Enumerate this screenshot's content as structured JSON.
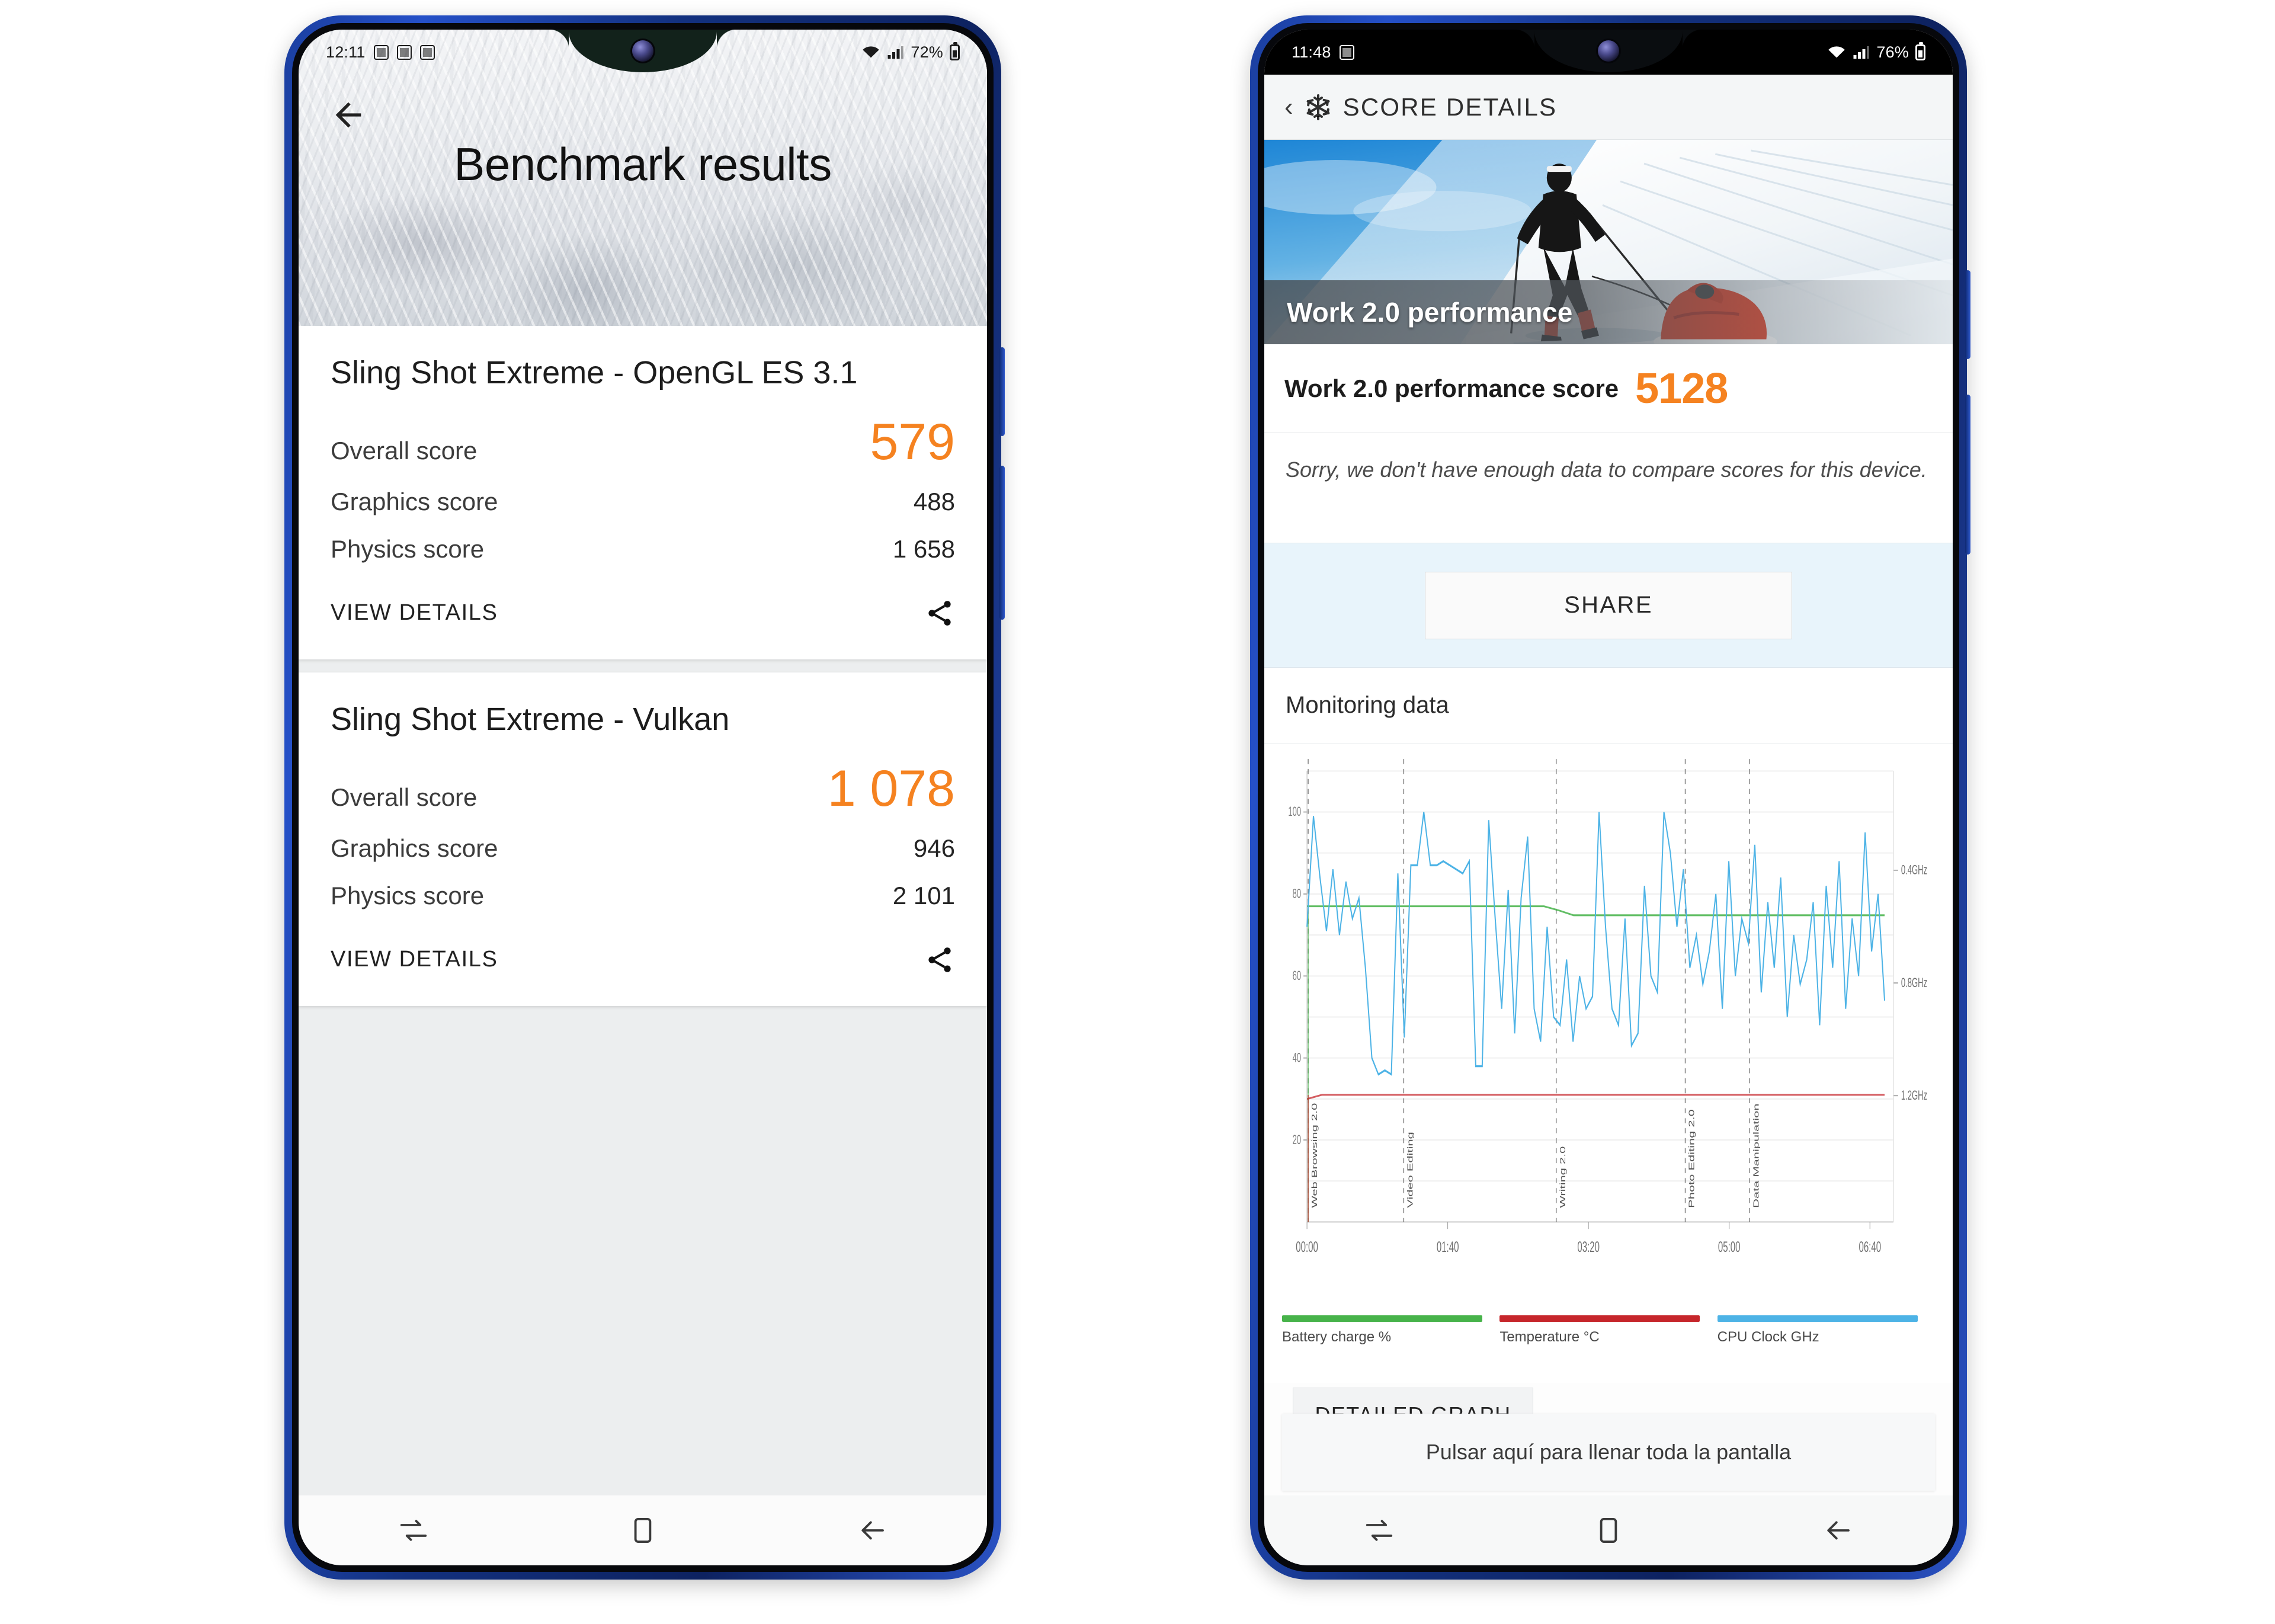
{
  "left_phone": {
    "status_bar": {
      "time": "12:11",
      "battery_percent": "72%",
      "icons": [
        "image-icon",
        "screenshot-icon",
        "alarm-icon",
        "wifi-icon",
        "signal-icon",
        "battery-icon"
      ]
    },
    "back_icon": "back-arrow-icon",
    "header_title": "Benchmark results",
    "cards": [
      {
        "title": "Sling Shot Extreme - OpenGL ES 3.1",
        "rows": [
          {
            "label": "Overall score",
            "value": "579",
            "accent": true
          },
          {
            "label": "Graphics score",
            "value": "488",
            "accent": false
          },
          {
            "label": "Physics score",
            "value": "1 658",
            "accent": false
          }
        ],
        "details_label": "VIEW DETAILS",
        "share_icon": "share-icon"
      },
      {
        "title": "Sling Shot Extreme - Vulkan",
        "rows": [
          {
            "label": "Overall score",
            "value": "1 078",
            "accent": true
          },
          {
            "label": "Graphics score",
            "value": "946",
            "accent": false
          },
          {
            "label": "Physics score",
            "value": "2 101",
            "accent": false
          }
        ],
        "details_label": "VIEW DETAILS",
        "share_icon": "share-icon"
      }
    ],
    "nav_bar": {
      "recents_icon": "recents-icon",
      "home_icon": "home-icon",
      "back_icon": "back-icon"
    }
  },
  "right_phone": {
    "status_bar": {
      "time": "11:48",
      "battery_percent": "76%",
      "icons": [
        "screenshot-icon",
        "wifi-icon",
        "signal-icon",
        "battery-icon"
      ]
    },
    "app_bar": {
      "back_chevron": "chevron-left-icon",
      "brand_icon": "snowflake-icon",
      "title": "SCORE DETAILS"
    },
    "banner": {
      "caption": "Work 2.0 performance",
      "image_alt": "skier-pulling-sled-photo"
    },
    "score": {
      "label": "Work 2.0 performance score",
      "value": "5128"
    },
    "note": "Sorry, we don't have enough data to compare scores for this device.",
    "share_label": "SHARE",
    "monitoring_heading": "Monitoring data",
    "detailed_graph_label": "DETAILED GRAPH",
    "fullscreen_hint": "Pulsar aquí para llenar toda la pantalla",
    "nav_bar": {
      "recents_icon": "recents-icon",
      "home_icon": "home-icon",
      "back_icon": "back-icon"
    }
  },
  "colors": {
    "accent_orange": "#f58220",
    "battery_green": "#47b34a",
    "temperature_red": "#c6262b",
    "cpu_blue": "#4db3e6",
    "phone_blue": "#1b3fa0"
  },
  "chart_data": {
    "type": "line",
    "title": "Monitoring data",
    "xlabel": "",
    "ylabel": "",
    "grid": true,
    "legend_position": "bottom",
    "x_ticks": [
      "00:00",
      "01:40",
      "03:20",
      "05:00",
      "06:40"
    ],
    "y_left_ticks": [
      "100",
      "80",
      "60",
      "40",
      "20"
    ],
    "y_left_range": [
      0,
      110
    ],
    "y_right_ticks": [
      "1.2GHz",
      "0.8GHz",
      "0.4GHz"
    ],
    "annotations": [
      {
        "label": "Web Browsing 2.0",
        "x_time": "00:00"
      },
      {
        "label": "Video Editing",
        "x_time": "01:07"
      },
      {
        "label": "Writing 2.0",
        "x_time": "02:52"
      },
      {
        "label": "Photo Editing 2.0",
        "x_time": "04:25"
      },
      {
        "label": "Data Manipulation",
        "x_time": "05:12"
      }
    ],
    "series": [
      {
        "name": "Battery charge %",
        "color": "#47b34a",
        "unit": "%",
        "values": [
          77,
          77,
          77,
          77,
          77,
          77,
          77,
          77,
          77,
          77,
          77,
          77,
          77,
          77,
          77,
          77,
          77,
          76,
          76,
          76,
          76,
          76,
          76,
          76,
          76,
          76,
          76,
          76,
          76,
          76,
          76,
          76,
          76,
          76,
          76,
          76,
          76,
          76,
          76,
          76
        ]
      },
      {
        "name": "Temperature °C",
        "color": "#c6262b",
        "unit": "°C",
        "values": [
          30,
          31,
          31,
          31,
          31,
          31,
          31,
          31,
          31,
          31,
          31,
          31,
          31,
          31,
          31,
          31,
          31,
          31,
          31,
          31,
          31,
          31,
          31,
          31,
          31,
          31,
          31,
          31,
          31,
          31,
          31,
          31,
          31,
          31,
          31,
          31,
          31,
          31,
          31,
          31
        ]
      },
      {
        "name": "CPU Clock GHz",
        "color": "#4db3e6",
        "unit": "GHz",
        "values": [
          72,
          99,
          84,
          71,
          86,
          70,
          83,
          74,
          79,
          62,
          40,
          36,
          37,
          36,
          85,
          45,
          87,
          87,
          100,
          87,
          87,
          88,
          87,
          86,
          85,
          88,
          38,
          38,
          98,
          74,
          52,
          81,
          46,
          79,
          94,
          52,
          44,
          72,
          50,
          48,
          64,
          44,
          60,
          52,
          55,
          100,
          72,
          52,
          48,
          74,
          43,
          46,
          82,
          60,
          56,
          100,
          90,
          72,
          86,
          62,
          70,
          58,
          66,
          80,
          52,
          88,
          60,
          74,
          68,
          92,
          56,
          78,
          62,
          84,
          50,
          70,
          58,
          64,
          78,
          48,
          82,
          62,
          88,
          52,
          74,
          60,
          95,
          66,
          80,
          54
        ]
      }
    ]
  }
}
